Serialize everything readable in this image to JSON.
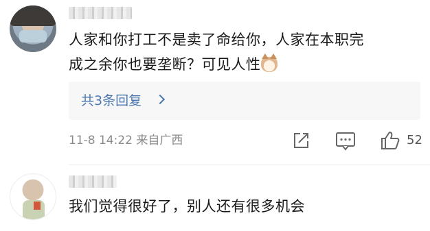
{
  "comments": [
    {
      "text_line1": "人家和你打工不是卖了命给你，人家在本职完",
      "text_line2": "成之余你也要垄断？可见人性",
      "replies_label": "共3条回复",
      "meta": "11-8 14:22 来自广西",
      "likes": "52"
    },
    {
      "text": "我们觉得很好了，别人还有很多机会"
    }
  ],
  "colors": {
    "link": "#4b77b0",
    "meta": "#8a8a8a"
  },
  "icons": [
    "share-icon",
    "comment-icon",
    "like-icon",
    "chevron-right-icon",
    "cat-emoji-icon"
  ]
}
